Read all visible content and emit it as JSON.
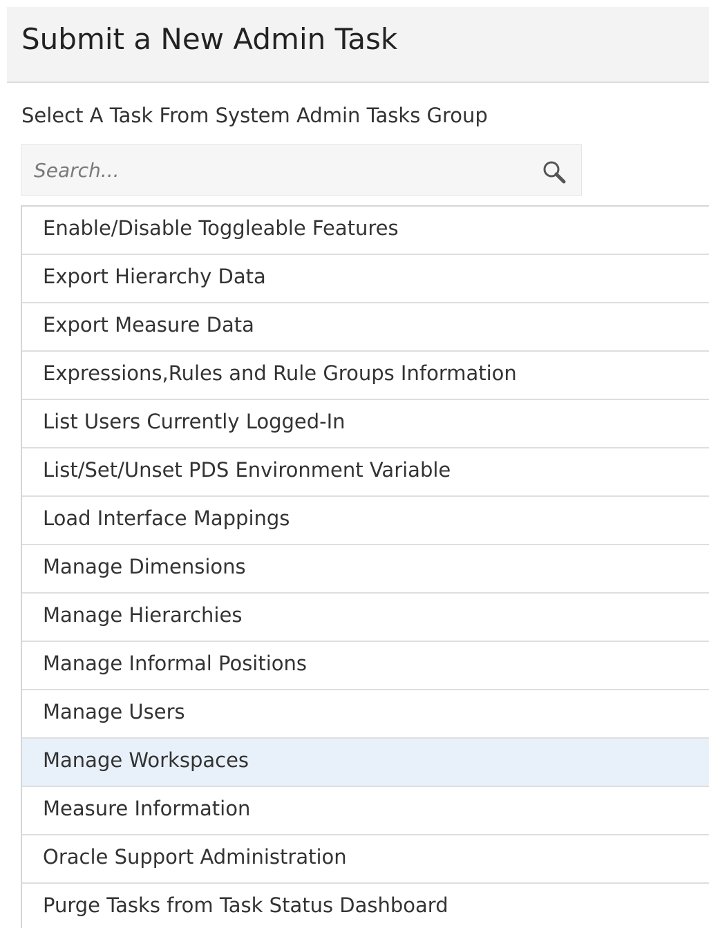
{
  "header": {
    "title": "Submit a New Admin Task"
  },
  "group_label": "Select A Task From System Admin Tasks Group",
  "search": {
    "placeholder": "Search...",
    "value": "",
    "icon": "search-icon"
  },
  "tasks": [
    {
      "label": "Enable/Disable Toggleable Features",
      "selected": false
    },
    {
      "label": "Export Hierarchy Data",
      "selected": false
    },
    {
      "label": "Export Measure Data",
      "selected": false
    },
    {
      "label": "Expressions,Rules and Rule Groups Information",
      "selected": false
    },
    {
      "label": "List Users Currently Logged-In",
      "selected": false
    },
    {
      "label": "List/Set/Unset PDS Environment Variable",
      "selected": false
    },
    {
      "label": "Load Interface Mappings",
      "selected": false
    },
    {
      "label": "Manage Dimensions",
      "selected": false
    },
    {
      "label": "Manage Hierarchies",
      "selected": false
    },
    {
      "label": "Manage Informal Positions",
      "selected": false
    },
    {
      "label": "Manage Users",
      "selected": false
    },
    {
      "label": "Manage Workspaces",
      "selected": true
    },
    {
      "label": "Measure Information",
      "selected": false
    },
    {
      "label": "Oracle Support Administration",
      "selected": false
    },
    {
      "label": "Purge Tasks from Task Status Dashboard",
      "selected": false
    }
  ],
  "colors": {
    "header_bg": "#f3f3f3",
    "selected_row_bg": "#e8f1fa",
    "text": "#333333"
  }
}
